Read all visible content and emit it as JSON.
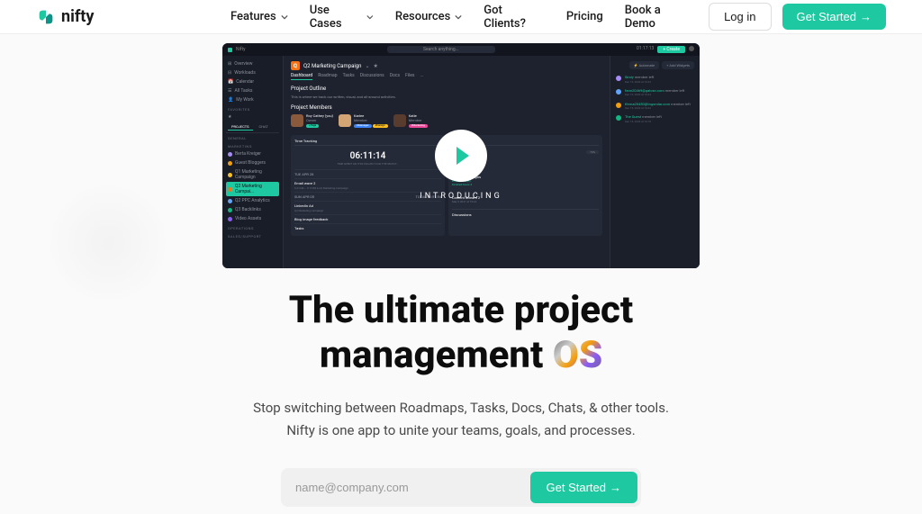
{
  "brand": {
    "name": "nifty"
  },
  "nav": {
    "items": [
      {
        "label": "Features",
        "hasDropdown": true
      },
      {
        "label": "Use Cases",
        "hasDropdown": true
      },
      {
        "label": "Resources",
        "hasDropdown": true
      },
      {
        "label": "Got Clients?",
        "hasDropdown": false
      },
      {
        "label": "Pricing",
        "hasDropdown": false
      },
      {
        "label": "Book a Demo",
        "hasDropdown": false
      }
    ],
    "login": "Log in",
    "cta": "Get Started"
  },
  "hero": {
    "title_line1": "The ultimate project",
    "title_line2_a": "management ",
    "title_line2_b": "OS",
    "desc_line1": "Stop switching between Roadmaps, Tasks, Docs, Chats, & other tools.",
    "desc_line2": "Nifty is one app to unite your teams, goals, and processes.",
    "email_placeholder": "name@company.com",
    "email_cta": "Get Started"
  },
  "video": {
    "introducing": "INTRODUCING",
    "topbar": {
      "brand": "Nifty",
      "search": "Search anything...",
      "timer": "01:17:13",
      "create": "+ Create"
    },
    "sidebar": {
      "nav": [
        "Overview",
        "Workloads",
        "Calendar",
        "All Tasks",
        "My Work"
      ],
      "favorites_label": "FAVORITES",
      "tabs": [
        "PROJECTS",
        "CHAT"
      ],
      "general_label": "GENERAL",
      "marketing_label": "MARKETING",
      "user": "Berta Kreiger",
      "projects": [
        "Guest Bloggers",
        "Q1 Marketing Campaign",
        "Q2 Marketing Campai...",
        "Q2 PPC Analytics",
        "Q3 Backlinks",
        "Video Assets"
      ],
      "operations_label": "OPERATIONS",
      "sales_label": "SALES/SUPPORT"
    },
    "main": {
      "project_letter": "Q",
      "project_name": "Q2 Marketing Campaign",
      "tabs": [
        "Dashboard",
        "Roadmap",
        "Tasks",
        "Discussions",
        "Docs",
        "Files",
        "..."
      ],
      "outline_title": "Project Outline",
      "outline_desc": "This is where we track our written, visual, and all-around activities.",
      "members_title": "Project Members",
      "members": [
        {
          "name": "Roy Cathey (you)",
          "role": "Owner",
          "badge": "+Tags",
          "badgeColor": "#1ec8a0",
          "avatarColor": "#8b5a3c"
        },
        {
          "name": "Karlee",
          "role": "Member",
          "badge": "#Manager",
          "badgeColor": "#3b82f6",
          "avatarColor": "#d4a574",
          "badge2": "#Design"
        },
        {
          "name": "Katie",
          "role": "Member",
          "badge": "#Marketing",
          "badgeColor": "#ec4899",
          "avatarColor": "#5a3c2e"
        }
      ],
      "panel1": {
        "title": "Time Tracking",
        "time": "06:11:14",
        "subtext": "TIME SPENT ON THIS PROJECT FOR THE SELECT...",
        "date1": "TUE APR 28",
        "task1": "Email wave 2",
        "task1_sub": "6:41AM – 9:11PM  ●  Q2 Marketing Campaign",
        "date2": "SUN APR 05",
        "total": "TOTAL  01:51:54",
        "task2": "LinkedIn Ad",
        "task3": "Blog image feedback",
        "task4": "Tasks"
      },
      "panel2": {
        "title": "Milestones",
        "item1": "Content Stream 1",
        "item1_sub": "Sat 14 Mar '15 (46 days)",
        "item1_sub2": "3 Open Tasks",
        "item1_sub3": "Finished hours 3",
        "progress1": "73%",
        "item2": "Social Campaigns",
        "item2_sub": "Fri 20 (48 days)",
        "item2_sub2": "Finished hours 3",
        "item3": "Content Stream 2",
        "item3_sub": "May 5 2021 at 15:24",
        "more": "Discussions"
      }
    },
    "right": {
      "automate": "Automate",
      "addWidgets": "+ Add Widgets",
      "activity": [
        {
          "name": "Sindy",
          "action": "member left",
          "date": "Dec 15, 2020 at 10:43"
        },
        {
          "name": "fann20469@galosn.com",
          "action": "member left",
          "date": "Dec 15, 2020 at 10:44"
        },
        {
          "name": "tferna20450@tngomlar.com",
          "action": "member left",
          "date": "Dec 15, 2020 at 10:44"
        },
        {
          "name": "The Guest",
          "action": "member left",
          "date": "Dec 15, 2020 at 10:18"
        }
      ]
    }
  }
}
